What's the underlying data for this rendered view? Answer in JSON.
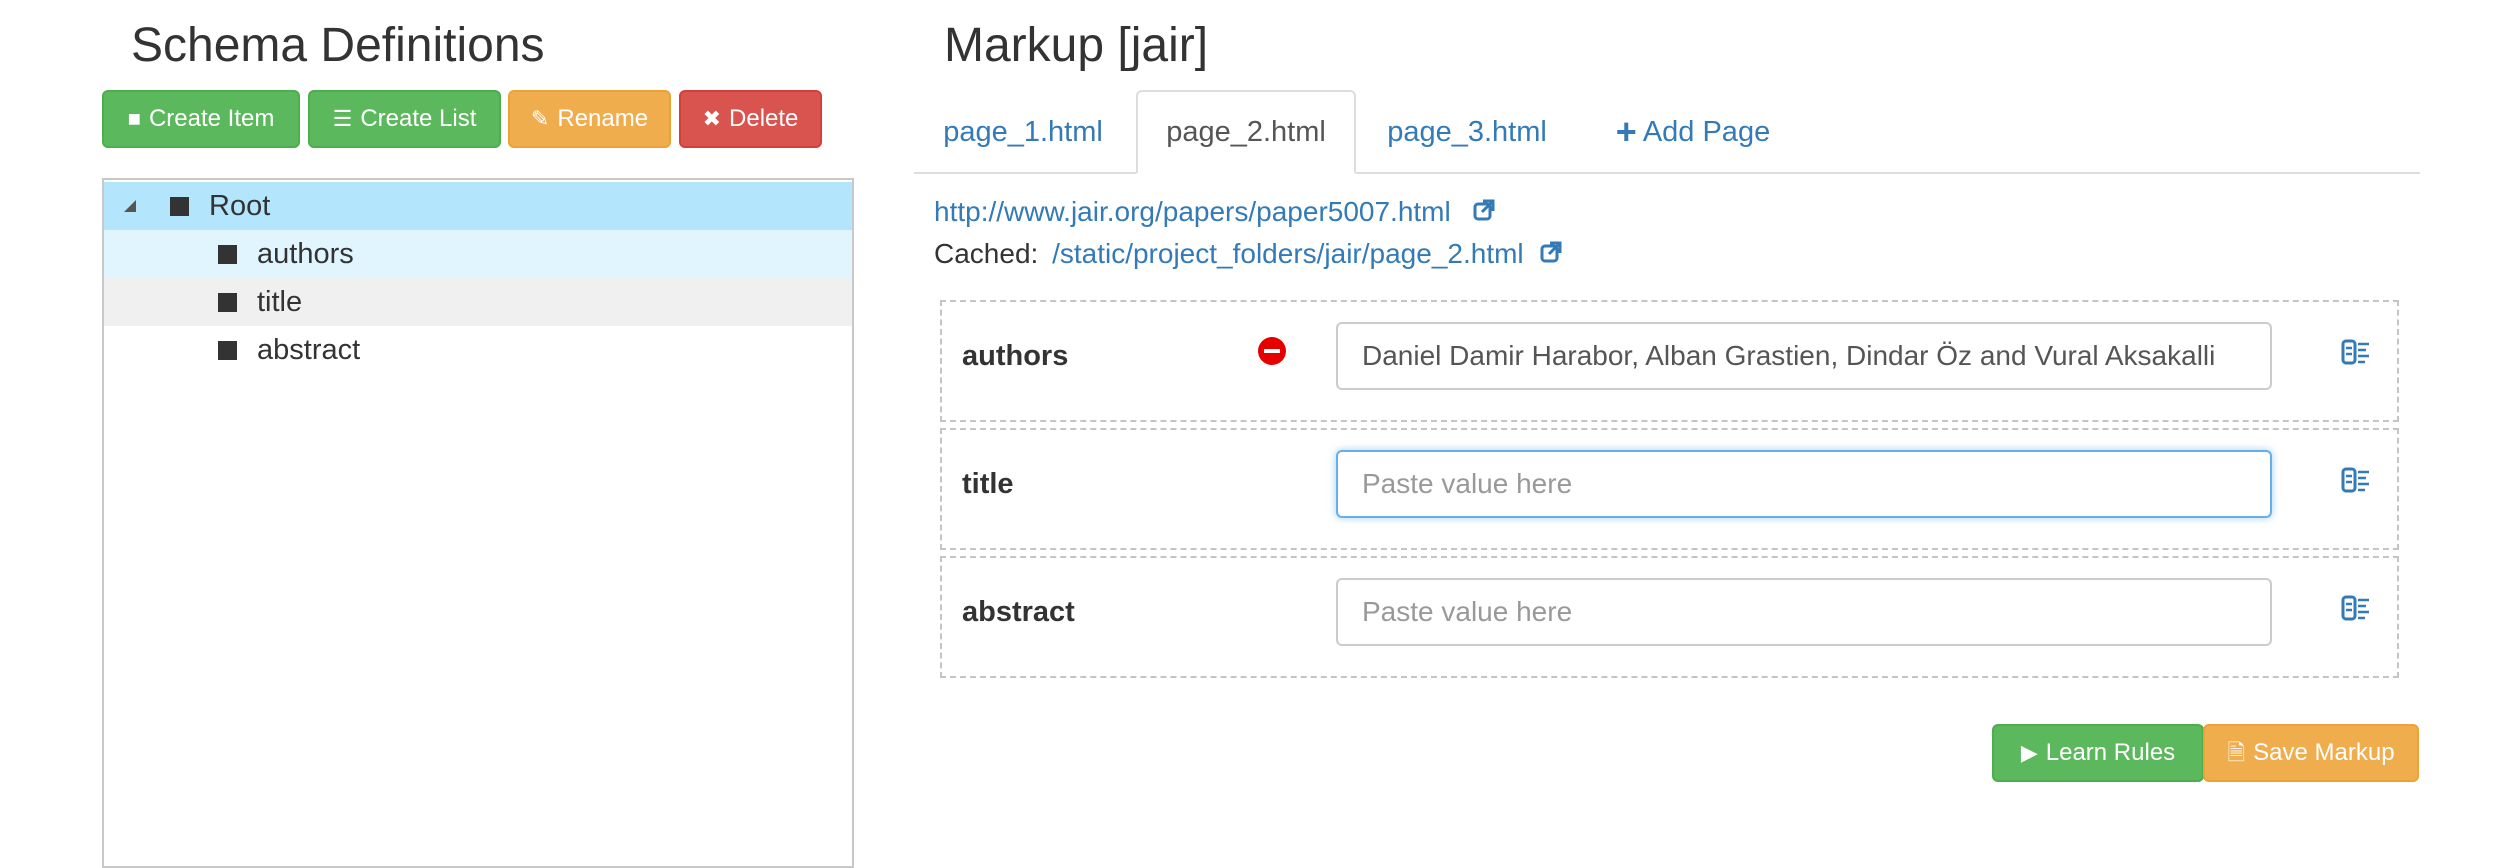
{
  "left_panel": {
    "title": "Schema Definitions",
    "buttons": {
      "create_item": "Create Item",
      "create_list": "Create List",
      "rename": "Rename",
      "delete": "Delete"
    },
    "tree": {
      "root": "Root",
      "children": [
        "authors",
        "title",
        "abstract"
      ]
    }
  },
  "right_panel": {
    "title": "Markup [jair]",
    "tabs": [
      "page_1.html",
      "page_2.html",
      "page_3.html"
    ],
    "active_tab": "page_2.html",
    "add_page": "Add Page",
    "source_url": "http://www.jair.org/papers/paper5007.html",
    "cached_label": "Cached:",
    "cached_url": "/static/project_folders/jair/page_2.html",
    "fields": [
      {
        "label": "authors",
        "value": "Daniel Damir Harabor, Alban Grastien, Dindar Öz and Vural Aksakalli",
        "placeholder": ""
      },
      {
        "label": "title",
        "value": "",
        "placeholder": "Paste value here"
      },
      {
        "label": "abstract",
        "value": "",
        "placeholder": "Paste value here"
      }
    ],
    "buttons": {
      "learn_rules": "Learn Rules",
      "save_markup": "Save Markup"
    }
  },
  "colors": {
    "green": "#5cb85c",
    "orange": "#f0ad4e",
    "red": "#d9534f",
    "link": "#337ab7",
    "tree_selected": "#b3e5fc",
    "tree_hover": "#e1f5fe"
  }
}
